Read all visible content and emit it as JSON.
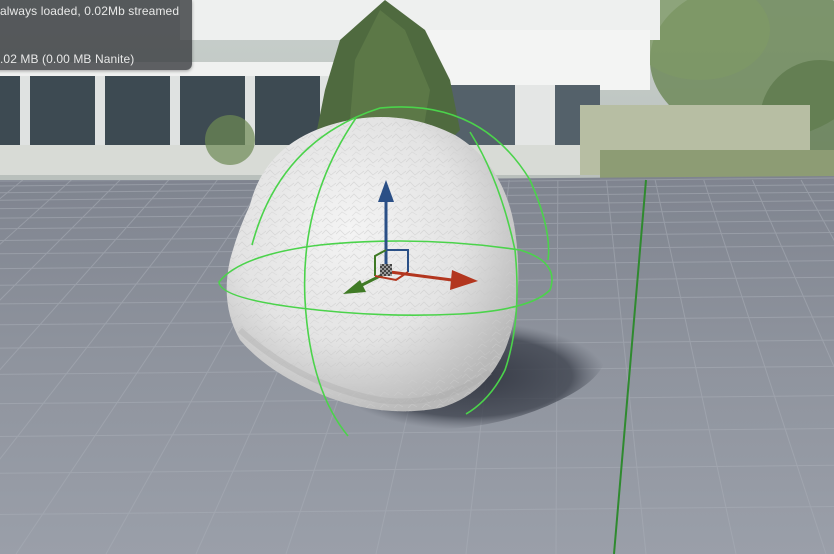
{
  "viewport": {
    "stats_line_1": "always loaded, 0.02Mb streamed",
    "stats_line_2": ".02 MB (0.00 MB Nanite)"
  },
  "scene": {
    "selected_object": "rock-mesh",
    "gizmo": {
      "mode": "translate",
      "axes": [
        "x-axis",
        "y-axis",
        "z-axis"
      ]
    }
  },
  "colors": {
    "x_axis": "#b3361f",
    "y_axis": "#3f7a25",
    "z_axis": "#2a4f86",
    "selection_outline": "#4bd34b",
    "floor": "#8a8f9a",
    "overlay_bg": "#3c3e42"
  }
}
